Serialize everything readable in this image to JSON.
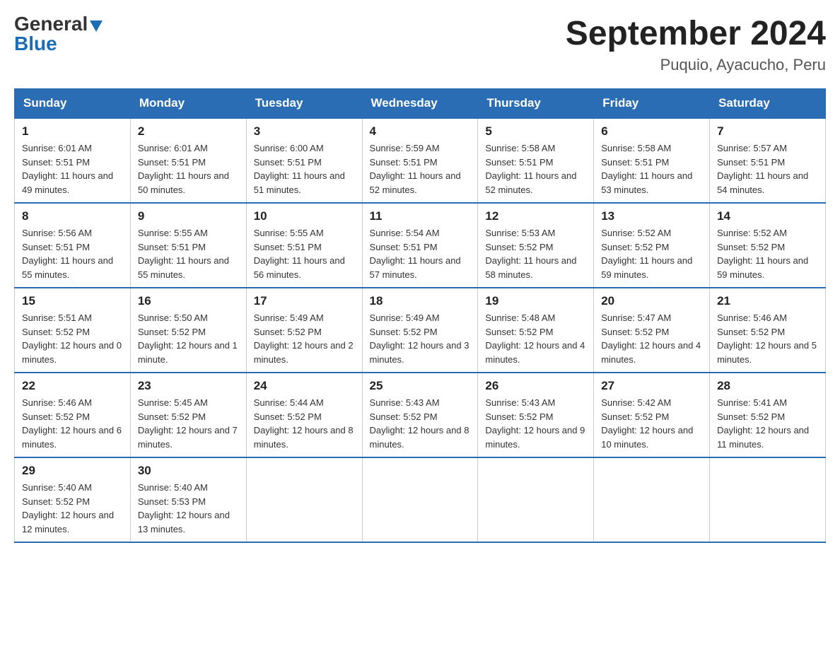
{
  "header": {
    "logo_general": "General",
    "logo_blue": "Blue",
    "title": "September 2024",
    "location": "Puquio, Ayacucho, Peru"
  },
  "days_of_week": [
    "Sunday",
    "Monday",
    "Tuesday",
    "Wednesday",
    "Thursday",
    "Friday",
    "Saturday"
  ],
  "weeks": [
    [
      {
        "day": "1",
        "sunrise": "6:01 AM",
        "sunset": "5:51 PM",
        "daylight": "11 hours and 49 minutes."
      },
      {
        "day": "2",
        "sunrise": "6:01 AM",
        "sunset": "5:51 PM",
        "daylight": "11 hours and 50 minutes."
      },
      {
        "day": "3",
        "sunrise": "6:00 AM",
        "sunset": "5:51 PM",
        "daylight": "11 hours and 51 minutes."
      },
      {
        "day": "4",
        "sunrise": "5:59 AM",
        "sunset": "5:51 PM",
        "daylight": "11 hours and 52 minutes."
      },
      {
        "day": "5",
        "sunrise": "5:58 AM",
        "sunset": "5:51 PM",
        "daylight": "11 hours and 52 minutes."
      },
      {
        "day": "6",
        "sunrise": "5:58 AM",
        "sunset": "5:51 PM",
        "daylight": "11 hours and 53 minutes."
      },
      {
        "day": "7",
        "sunrise": "5:57 AM",
        "sunset": "5:51 PM",
        "daylight": "11 hours and 54 minutes."
      }
    ],
    [
      {
        "day": "8",
        "sunrise": "5:56 AM",
        "sunset": "5:51 PM",
        "daylight": "11 hours and 55 minutes."
      },
      {
        "day": "9",
        "sunrise": "5:55 AM",
        "sunset": "5:51 PM",
        "daylight": "11 hours and 55 minutes."
      },
      {
        "day": "10",
        "sunrise": "5:55 AM",
        "sunset": "5:51 PM",
        "daylight": "11 hours and 56 minutes."
      },
      {
        "day": "11",
        "sunrise": "5:54 AM",
        "sunset": "5:51 PM",
        "daylight": "11 hours and 57 minutes."
      },
      {
        "day": "12",
        "sunrise": "5:53 AM",
        "sunset": "5:52 PM",
        "daylight": "11 hours and 58 minutes."
      },
      {
        "day": "13",
        "sunrise": "5:52 AM",
        "sunset": "5:52 PM",
        "daylight": "11 hours and 59 minutes."
      },
      {
        "day": "14",
        "sunrise": "5:52 AM",
        "sunset": "5:52 PM",
        "daylight": "11 hours and 59 minutes."
      }
    ],
    [
      {
        "day": "15",
        "sunrise": "5:51 AM",
        "sunset": "5:52 PM",
        "daylight": "12 hours and 0 minutes."
      },
      {
        "day": "16",
        "sunrise": "5:50 AM",
        "sunset": "5:52 PM",
        "daylight": "12 hours and 1 minute."
      },
      {
        "day": "17",
        "sunrise": "5:49 AM",
        "sunset": "5:52 PM",
        "daylight": "12 hours and 2 minutes."
      },
      {
        "day": "18",
        "sunrise": "5:49 AM",
        "sunset": "5:52 PM",
        "daylight": "12 hours and 3 minutes."
      },
      {
        "day": "19",
        "sunrise": "5:48 AM",
        "sunset": "5:52 PM",
        "daylight": "12 hours and 4 minutes."
      },
      {
        "day": "20",
        "sunrise": "5:47 AM",
        "sunset": "5:52 PM",
        "daylight": "12 hours and 4 minutes."
      },
      {
        "day": "21",
        "sunrise": "5:46 AM",
        "sunset": "5:52 PM",
        "daylight": "12 hours and 5 minutes."
      }
    ],
    [
      {
        "day": "22",
        "sunrise": "5:46 AM",
        "sunset": "5:52 PM",
        "daylight": "12 hours and 6 minutes."
      },
      {
        "day": "23",
        "sunrise": "5:45 AM",
        "sunset": "5:52 PM",
        "daylight": "12 hours and 7 minutes."
      },
      {
        "day": "24",
        "sunrise": "5:44 AM",
        "sunset": "5:52 PM",
        "daylight": "12 hours and 8 minutes."
      },
      {
        "day": "25",
        "sunrise": "5:43 AM",
        "sunset": "5:52 PM",
        "daylight": "12 hours and 8 minutes."
      },
      {
        "day": "26",
        "sunrise": "5:43 AM",
        "sunset": "5:52 PM",
        "daylight": "12 hours and 9 minutes."
      },
      {
        "day": "27",
        "sunrise": "5:42 AM",
        "sunset": "5:52 PM",
        "daylight": "12 hours and 10 minutes."
      },
      {
        "day": "28",
        "sunrise": "5:41 AM",
        "sunset": "5:52 PM",
        "daylight": "12 hours and 11 minutes."
      }
    ],
    [
      {
        "day": "29",
        "sunrise": "5:40 AM",
        "sunset": "5:52 PM",
        "daylight": "12 hours and 12 minutes."
      },
      {
        "day": "30",
        "sunrise": "5:40 AM",
        "sunset": "5:53 PM",
        "daylight": "12 hours and 13 minutes."
      },
      null,
      null,
      null,
      null,
      null
    ]
  ],
  "labels": {
    "sunrise": "Sunrise:",
    "sunset": "Sunset:",
    "daylight": "Daylight:"
  }
}
